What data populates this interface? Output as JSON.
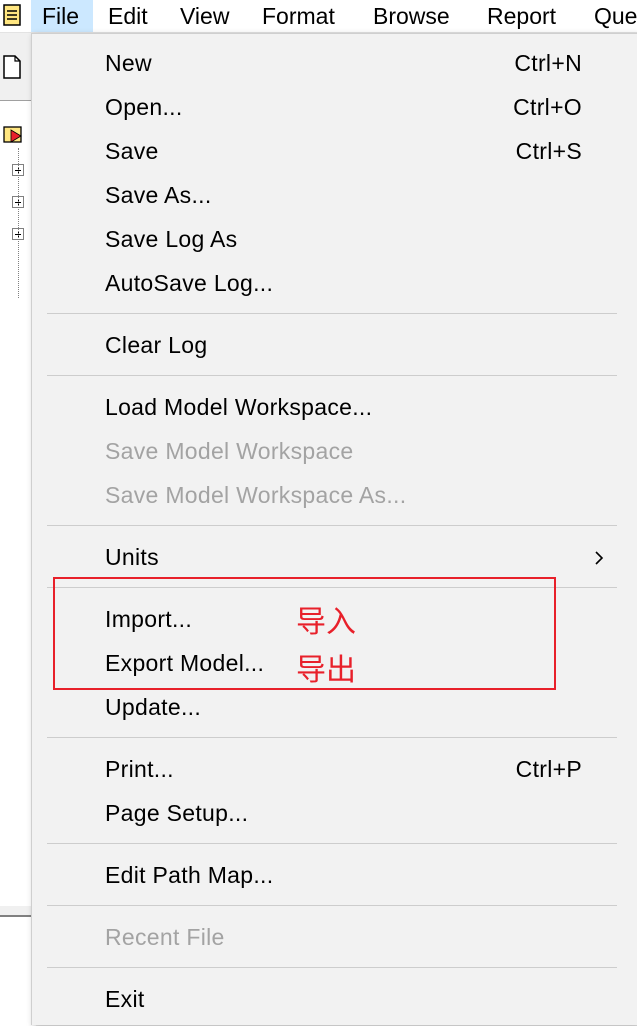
{
  "menubar": {
    "items": [
      {
        "label": "File",
        "active": true
      },
      {
        "label": "Edit"
      },
      {
        "label": "View"
      },
      {
        "label": "Format"
      },
      {
        "label": "Browse"
      },
      {
        "label": "Report"
      },
      {
        "label": "Que"
      }
    ]
  },
  "file_menu": {
    "new": {
      "label": "New",
      "shortcut": "Ctrl+N"
    },
    "open": {
      "label": "Open...",
      "shortcut": "Ctrl+O"
    },
    "save": {
      "label": "Save",
      "shortcut": "Ctrl+S"
    },
    "save_as": {
      "label": "Save As..."
    },
    "save_log_as": {
      "label": "Save Log As"
    },
    "autosave_log": {
      "label": "AutoSave Log..."
    },
    "clear_log": {
      "label": "Clear Log"
    },
    "load_model_workspace": {
      "label": "Load Model Workspace..."
    },
    "save_model_workspace": {
      "label": "Save Model Workspace",
      "disabled": true
    },
    "save_model_workspace_as": {
      "label": "Save Model Workspace As...",
      "disabled": true
    },
    "units": {
      "label": "Units",
      "has_submenu": true
    },
    "import": {
      "label": "Import..."
    },
    "export_model": {
      "label": "Export Model..."
    },
    "update": {
      "label": "Update..."
    },
    "print": {
      "label": "Print...",
      "shortcut": "Ctrl+P"
    },
    "page_setup": {
      "label": "Page Setup..."
    },
    "edit_path_map": {
      "label": "Edit Path Map..."
    },
    "recent_file": {
      "label": "Recent File",
      "disabled": true
    },
    "exit": {
      "label": "Exit"
    }
  },
  "annotations": {
    "import_note": "导入",
    "export_note": "导出",
    "color": "#e8202a"
  },
  "colors": {
    "menu_bg": "#f2f2f2",
    "disabled_text": "#a3a3a3",
    "active_menubar": "#cce8ff"
  }
}
